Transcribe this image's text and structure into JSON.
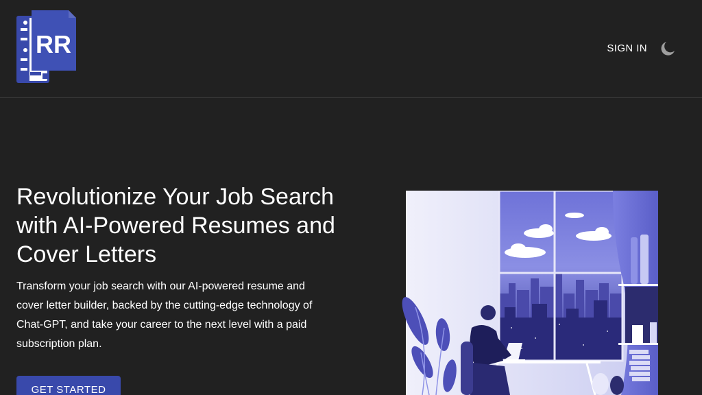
{
  "header": {
    "logo_text": "RR",
    "signin_label": "SIGN IN",
    "theme_icon": "moon-icon"
  },
  "hero": {
    "title": "Revolutionize Your Job Search with AI-Powered Resumes and Cover Letters",
    "description": "Transform your job search with our AI-powered resume and cover letter builder, backed by the cutting-edge technology of Chat-GPT, and take your career to the next level with a paid subscription plan.",
    "cta_label": "GET STARTED"
  },
  "colors": {
    "background": "#212121",
    "accent": "#3949ab",
    "text": "#ffffff"
  }
}
